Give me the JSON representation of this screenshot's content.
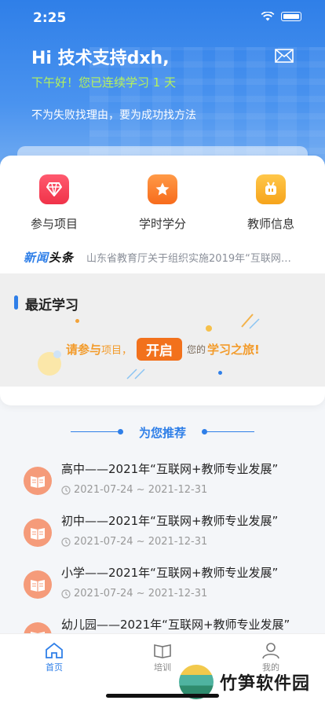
{
  "status_bar": {
    "time": "2:25"
  },
  "header": {
    "greeting": "Hi 技术支持dxh,",
    "sub_greeting": "下午好！您已连续学习 1 天",
    "motto": "不为失败找理由，要为成功找方法"
  },
  "quick_actions": [
    {
      "label": "参与项目",
      "icon": "diamond-icon",
      "color": "#f03249"
    },
    {
      "label": "学时学分",
      "icon": "star-icon",
      "color": "#f76b1c"
    },
    {
      "label": "教师信息",
      "icon": "robot-icon",
      "color": "#f6a41b"
    }
  ],
  "news": {
    "tag_part1": "新闻",
    "tag_part2": "头条",
    "headline": "山东省教育厅关于组织实施2019年“互联网+..."
  },
  "recent": {
    "title": "最近学习",
    "cta_part1": "请参与",
    "cta_part2": "项目，",
    "cta_button": "开启",
    "cta_part3": "您的",
    "cta_part4": "学习之旅!"
  },
  "recommend": {
    "title": "为您推荐",
    "items": [
      {
        "title": "高中——2021年“互联网+教师专业发展”",
        "date": "2021-07-24 ~ 2021-12-31"
      },
      {
        "title": "初中——2021年“互联网+教师专业发展”",
        "date": "2021-07-24 ~ 2021-12-31"
      },
      {
        "title": "小学——2021年“互联网+教师专业发展”",
        "date": "2021-07-24 ~ 2021-12-31"
      },
      {
        "title": "幼儿园——2021年“互联网+教师专业发展”",
        "date": ""
      }
    ]
  },
  "tabbar": {
    "home": "首页",
    "training": "培训",
    "profile": "我的"
  },
  "watermark": {
    "text": "竹笋软件园"
  },
  "colors": {
    "primary": "#2f7fe8",
    "accent_orange": "#f2711c",
    "greeting_green": "#b4f25b"
  }
}
